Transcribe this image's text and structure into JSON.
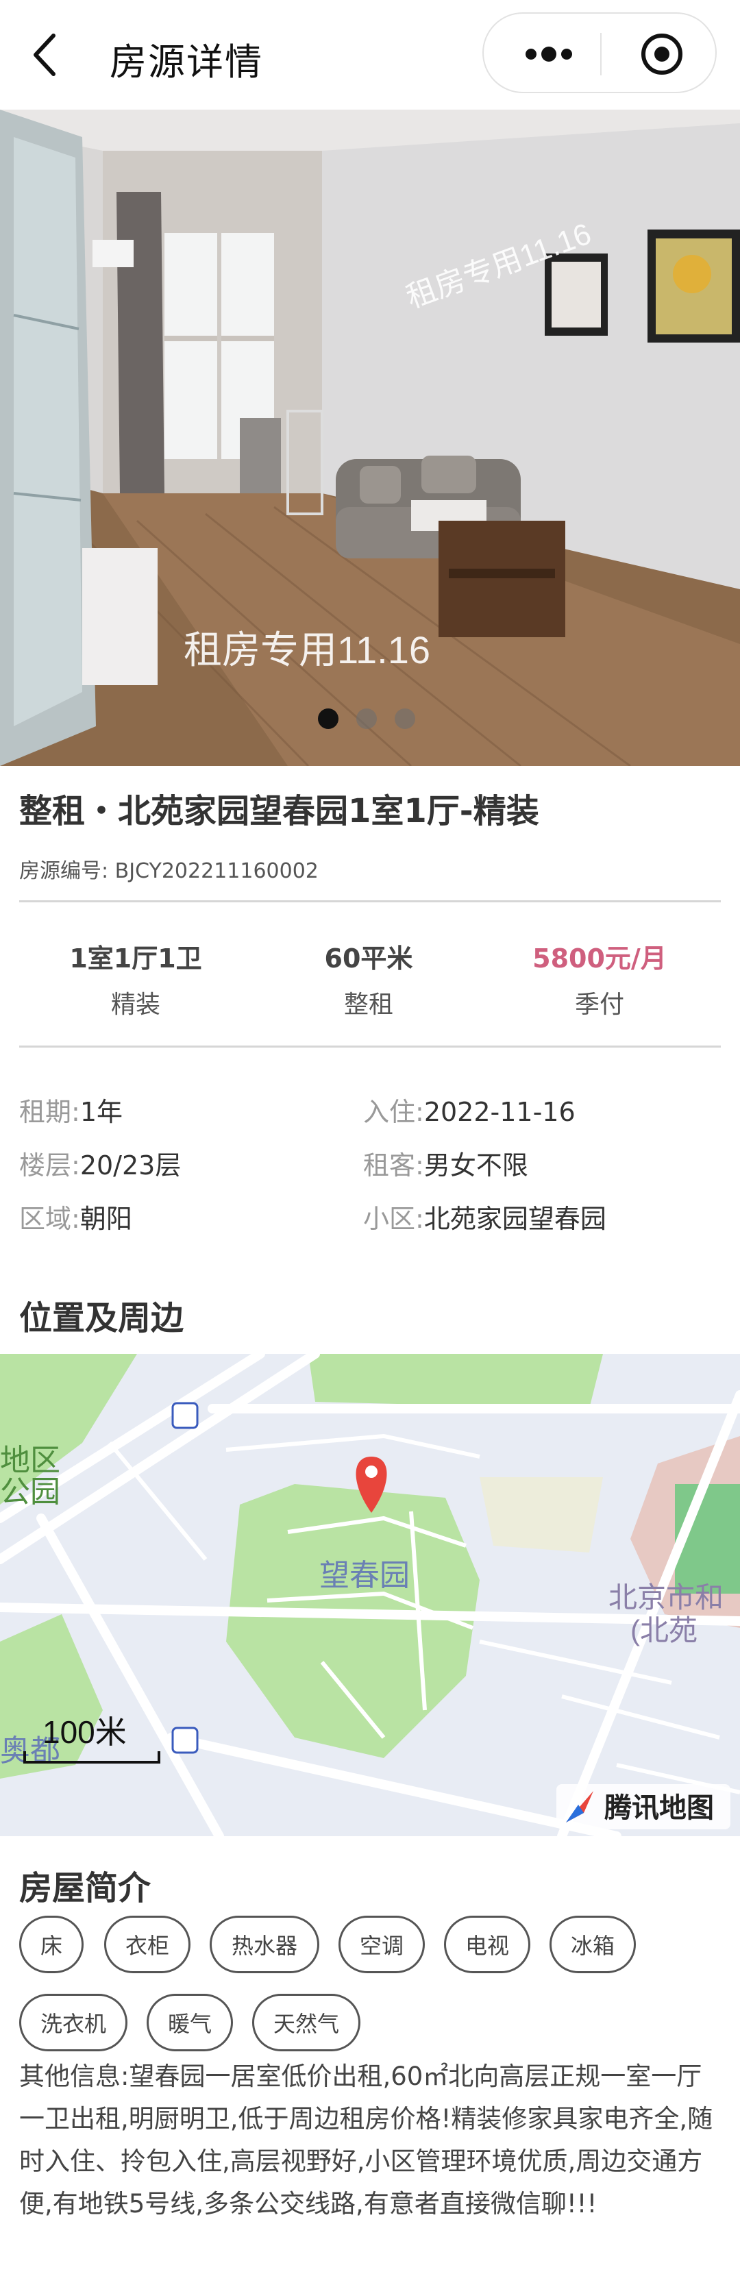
{
  "nav": {
    "title": "房源详情",
    "back_icon": "chevron-left-icon",
    "more_icon": "more-dots-icon",
    "close_icon": "target-circle-icon"
  },
  "gallery": {
    "watermark_top": "租房专用11.16",
    "watermark_bottom": "租房专用11.16",
    "slide_count": 3,
    "active_slide": 1
  },
  "listing": {
    "title": "整租・北苑家园望春园1室1厅-精装",
    "code_label": "房源编号:",
    "code_value": "BJCY202211160002"
  },
  "stats": [
    {
      "top": "1室1厅1卫",
      "bottom": "精装"
    },
    {
      "top": "60平米",
      "bottom": "整租"
    },
    {
      "top": "5800元/月",
      "bottom": "季付"
    }
  ],
  "info": [
    {
      "label": "租期:",
      "value": "1年"
    },
    {
      "label": "入住:",
      "value": "2022-11-16"
    },
    {
      "label": "楼层:",
      "value": "20/23层"
    },
    {
      "label": "租客:",
      "value": "男女不限"
    },
    {
      "label": "区域:",
      "value": "朝阳"
    },
    {
      "label": "小区:",
      "value": "北苑家园望春园"
    }
  ],
  "location": {
    "section_title": "位置及周边",
    "map_labels": {
      "park": "望春园",
      "left_top": "地区",
      "left_mid": "公园",
      "right_school_1": "北京市和",
      "right_school_2": "(北苑",
      "left_bottom": "奥都",
      "scale": "100米",
      "brand": "腾讯地图"
    }
  },
  "intro": {
    "section_title": "房屋简介",
    "tags": [
      "床",
      "衣柜",
      "热水器",
      "空调",
      "电视",
      "冰箱",
      "洗衣机",
      "暖气",
      "天然气"
    ],
    "description": "其他信息:望春园一居室低价出租,60㎡北向高层正规一室一厅一卫出租,明厨明卫,低于周边租房价格!精装修家具家电齐全,随时入住、拎包入住,高层视野好,小区管理环境优质,周边交通方便,有地铁5号线,多条公交线路,有意者直接微信聊!!!"
  },
  "colors": {
    "price": "#cf5f7e",
    "map_green": "#b9e3a3",
    "map_bg": "#e8ecf4",
    "pin": "#e8453c"
  }
}
